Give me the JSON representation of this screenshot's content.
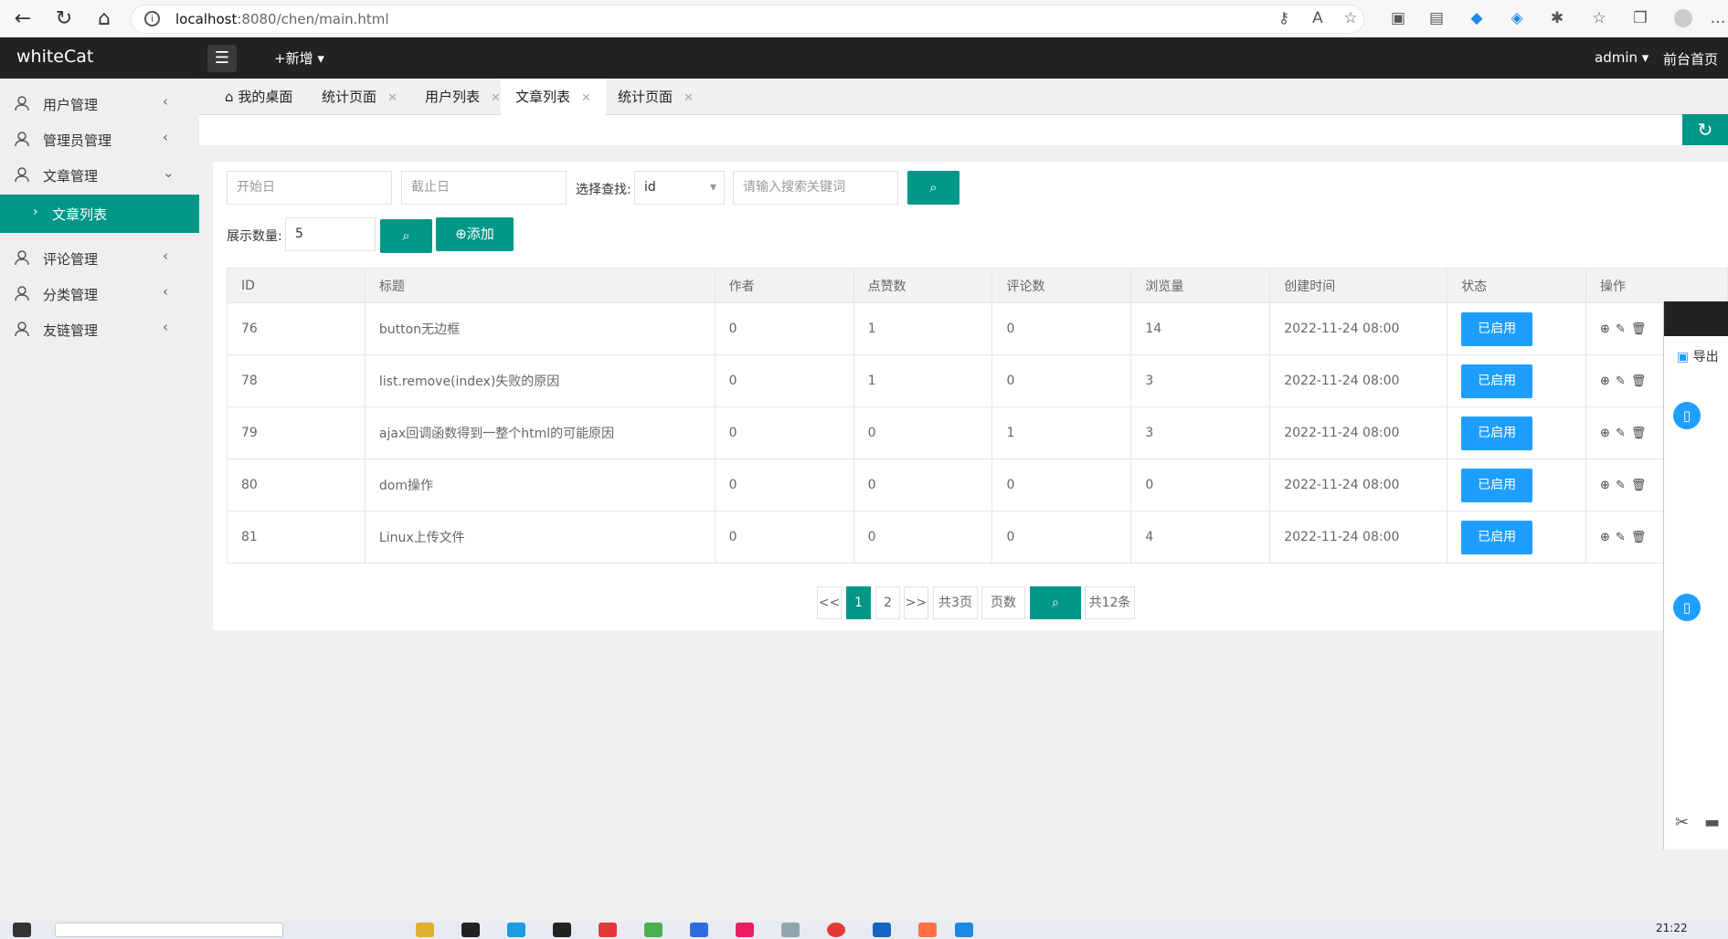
{
  "browser": {
    "url_host": "localhost",
    "url_rest": ":8080/chen/main.html"
  },
  "app": {
    "logo": "whiteCat",
    "new_label": "+新增",
    "user": "admin",
    "front_link": "前台首页"
  },
  "sidebar": {
    "items": [
      {
        "label": "用户管理"
      },
      {
        "label": "管理员管理"
      },
      {
        "label": "文章管理"
      },
      {
        "label": "评论管理"
      },
      {
        "label": "分类管理"
      },
      {
        "label": "友链管理"
      }
    ],
    "sub_active": "文章列表"
  },
  "tabs": [
    {
      "label": "我的桌面"
    },
    {
      "label": "统计页面"
    },
    {
      "label": "用户列表"
    },
    {
      "label": "文章列表"
    },
    {
      "label": "统计页面"
    }
  ],
  "filters": {
    "start_placeholder": "开始日",
    "end_placeholder": "截止日",
    "select_label": "选择查找:",
    "select_value": "id",
    "keyword_placeholder": "请输入搜索关键词",
    "page_size_label": "展示数量:",
    "page_size_value": "5",
    "add_label": "添加"
  },
  "table": {
    "headers": [
      "ID",
      "标题",
      "作者",
      "点赞数",
      "评论数",
      "浏览量",
      "创建时间",
      "状态",
      "操作"
    ],
    "rows": [
      {
        "id": "76",
        "title": "button无边框",
        "author": "0",
        "likes": "1",
        "comments": "0",
        "views": "14",
        "created": "2022-11-24 08:00",
        "status": "已启用"
      },
      {
        "id": "78",
        "title": "list.remove(index)失败的原因",
        "author": "0",
        "likes": "1",
        "comments": "0",
        "views": "3",
        "created": "2022-11-24 08:00",
        "status": "已启用"
      },
      {
        "id": "79",
        "title": "ajax回调函数得到一整个html的可能原因",
        "author": "0",
        "likes": "0",
        "comments": "1",
        "views": "3",
        "created": "2022-11-24 08:00",
        "status": "已启用"
      },
      {
        "id": "80",
        "title": "dom操作",
        "author": "0",
        "likes": "0",
        "comments": "0",
        "views": "0",
        "created": "2022-11-24 08:00",
        "status": "已启用"
      },
      {
        "id": "81",
        "title": "Linux上传文件",
        "author": "0",
        "likes": "0",
        "comments": "0",
        "views": "4",
        "created": "2022-11-24 08:00",
        "status": "已启用"
      }
    ]
  },
  "pagination": {
    "prev": "<<",
    "page1": "1",
    "page2": "2",
    "next": ">>",
    "total_pages": "共3页",
    "page_input_placeholder": "页数",
    "total_items": "共12条"
  },
  "floating_panel": {
    "export_label": "导出"
  },
  "taskbar": {
    "time": "21:22"
  }
}
